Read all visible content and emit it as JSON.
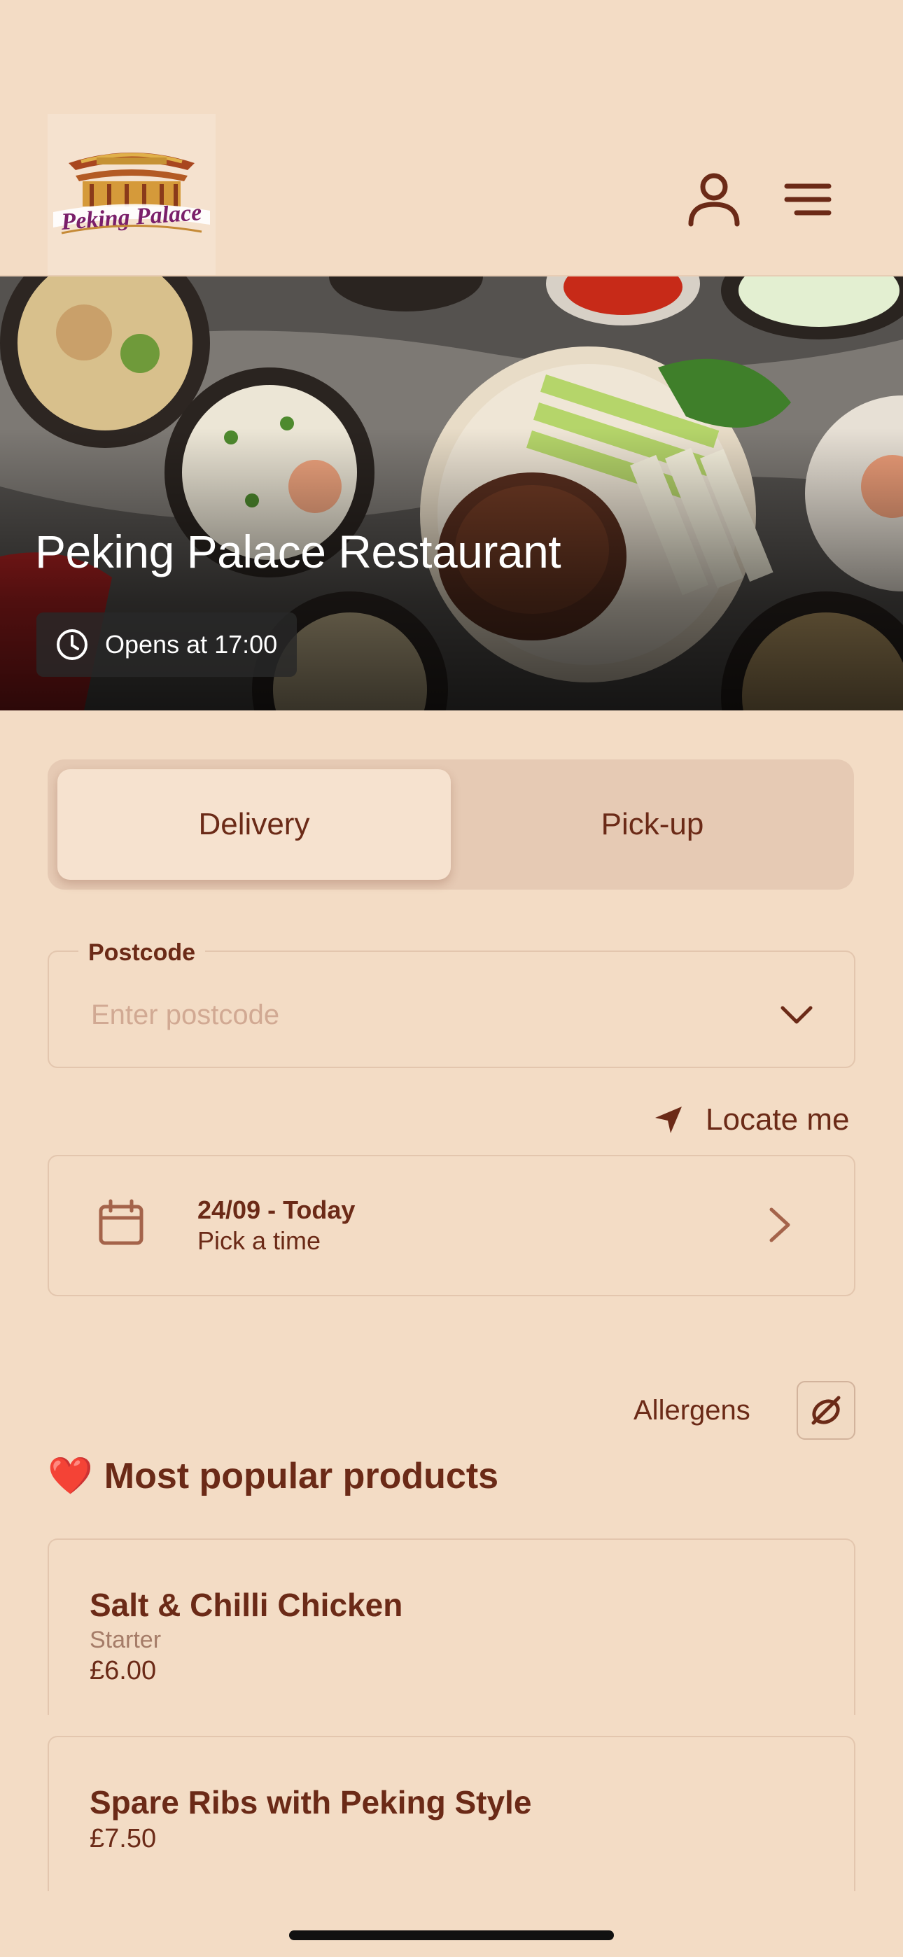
{
  "header": {
    "logo_text": "Peking Palace",
    "user_icon": "user-icon",
    "menu_icon": "hamburger-menu-icon"
  },
  "hero": {
    "title": "Peking Palace Restaurant",
    "opens_text": "Opens at 17:00",
    "opens_icon": "clock-icon"
  },
  "order_mode": {
    "options": [
      "Delivery",
      "Pick-up"
    ],
    "selected": "Delivery"
  },
  "postcode": {
    "label": "Postcode",
    "placeholder": "Enter postcode",
    "value": ""
  },
  "locate": {
    "label": "Locate me",
    "icon": "location-arrow-icon"
  },
  "date_picker": {
    "date": "24/09 - Today",
    "time": "Pick a time"
  },
  "allergens": {
    "label": "Allergens",
    "icon": "allergen-icon"
  },
  "popular": {
    "title": "Most popular products",
    "emoji": "❤️",
    "products": [
      {
        "name": "Salt & Chilli Chicken",
        "category": "Starter",
        "price": "£6.00"
      },
      {
        "name": "Spare Ribs with Peking Style",
        "price": "£7.50"
      }
    ]
  },
  "colors": {
    "background": "#f3dcc5",
    "primary_text": "#6b2a17",
    "segment_bg": "#e6cab4"
  }
}
